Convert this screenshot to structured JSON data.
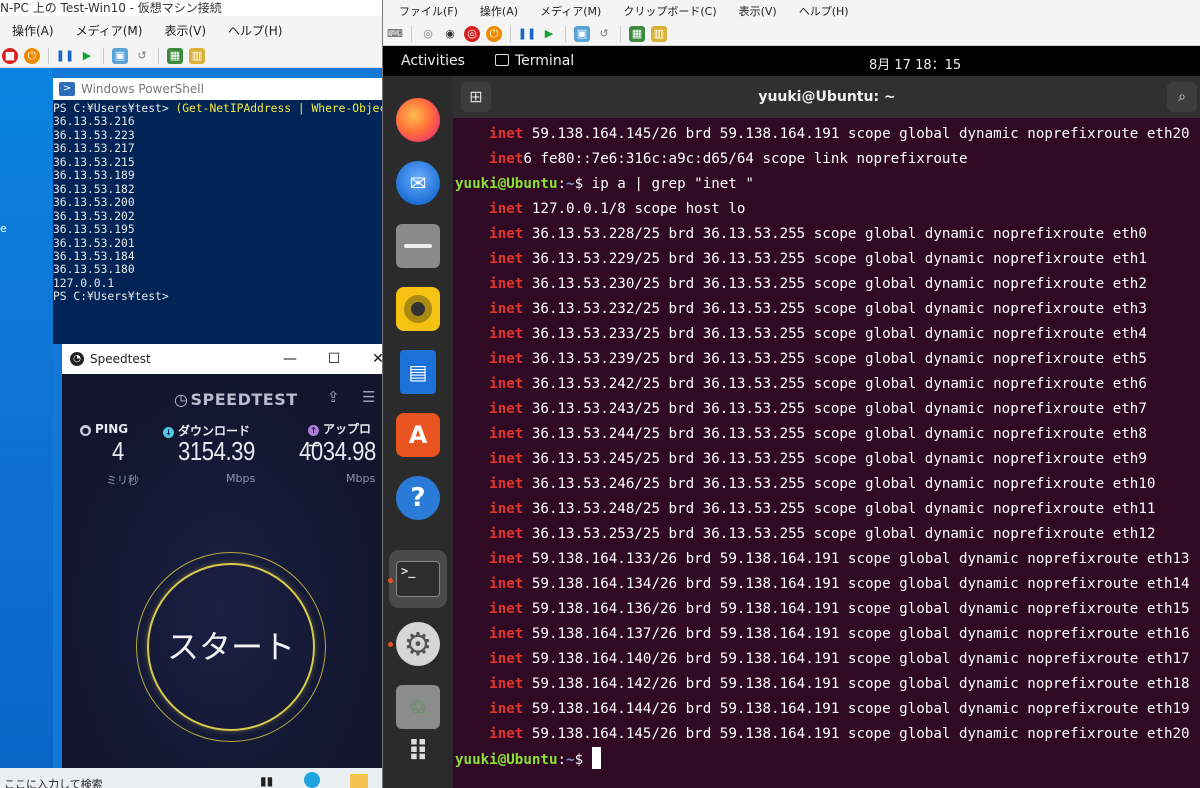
{
  "left_vm": {
    "window_title": "N-PC 上の Test-Win10 - 仮想マシン接続",
    "menu": [
      "操作(A)",
      "メディア(M)",
      "表示(V)",
      "ヘルプ(H)"
    ],
    "desktop_text": "e",
    "powershell": {
      "title": "Windows PowerShell",
      "prompt_line_prefix": "PS C:¥Users¥test> ",
      "command": "(Get-NetIPAddress | Where-Objec",
      "lines": [
        "36.13.53.216",
        "36.13.53.223",
        "36.13.53.217",
        "36.13.53.215",
        "36.13.53.189",
        "36.13.53.182",
        "36.13.53.200",
        "36.13.53.202",
        "36.13.53.195",
        "36.13.53.201",
        "36.13.53.184",
        "36.13.53.180",
        "127.0.0.1"
      ],
      "final_prompt": "PS C:¥Users¥test>"
    },
    "speedtest": {
      "title": "Speedtest",
      "logo": "SPEEDTEST",
      "ping_label": "PING",
      "ping_value": "4",
      "ping_unit": "ミリ秒",
      "download_label": "ダウンロード",
      "download_value": "3154.39",
      "download_unit": "Mbps",
      "upload_label": "アップロー",
      "upload_value": "4034.98",
      "upload_unit": "Mbps",
      "start_label": "スタート"
    },
    "taskbar_search": "ここに入力して検索"
  },
  "right_vm": {
    "menu": [
      "ファイル(F)",
      "操作(A)",
      "メディア(M)",
      "クリップボード(C)",
      "表示(V)",
      "ヘルプ(H)"
    ],
    "topbar": {
      "activities": "Activities",
      "app": "Terminal",
      "clock": "8月 17  18：15"
    },
    "terminal": {
      "title": "yuuki@Ubuntu: ~",
      "prompt_user": "yuuki@Ubuntu",
      "prompt_sep": ":",
      "prompt_path": "~",
      "prompt_sym": "$",
      "command": " ip a | grep \"inet \"",
      "top_lines": [
        {
          "kw": "inet",
          "rest": " 59.138.164.145/26 brd 59.138.164.191 scope global dynamic noprefixroute eth20"
        },
        {
          "kw": "inet",
          "rest": "6 fe80::7e6:316c:a9c:d65/64 scope link noprefixroute"
        }
      ],
      "lines": [
        {
          "kw": "inet",
          "rest": " 127.0.0.1/8 scope host lo"
        },
        {
          "kw": "inet",
          "rest": " 36.13.53.228/25 brd 36.13.53.255 scope global dynamic noprefixroute eth0"
        },
        {
          "kw": "inet",
          "rest": " 36.13.53.229/25 brd 36.13.53.255 scope global dynamic noprefixroute eth1"
        },
        {
          "kw": "inet",
          "rest": " 36.13.53.230/25 brd 36.13.53.255 scope global dynamic noprefixroute eth2"
        },
        {
          "kw": "inet",
          "rest": " 36.13.53.232/25 brd 36.13.53.255 scope global dynamic noprefixroute eth3"
        },
        {
          "kw": "inet",
          "rest": " 36.13.53.233/25 brd 36.13.53.255 scope global dynamic noprefixroute eth4"
        },
        {
          "kw": "inet",
          "rest": " 36.13.53.239/25 brd 36.13.53.255 scope global dynamic noprefixroute eth5"
        },
        {
          "kw": "inet",
          "rest": " 36.13.53.242/25 brd 36.13.53.255 scope global dynamic noprefixroute eth6"
        },
        {
          "kw": "inet",
          "rest": " 36.13.53.243/25 brd 36.13.53.255 scope global dynamic noprefixroute eth7"
        },
        {
          "kw": "inet",
          "rest": " 36.13.53.244/25 brd 36.13.53.255 scope global dynamic noprefixroute eth8"
        },
        {
          "kw": "inet",
          "rest": " 36.13.53.245/25 brd 36.13.53.255 scope global dynamic noprefixroute eth9"
        },
        {
          "kw": "inet",
          "rest": " 36.13.53.246/25 brd 36.13.53.255 scope global dynamic noprefixroute eth10"
        },
        {
          "kw": "inet",
          "rest": " 36.13.53.248/25 brd 36.13.53.255 scope global dynamic noprefixroute eth11"
        },
        {
          "kw": "inet",
          "rest": " 36.13.53.253/25 brd 36.13.53.255 scope global dynamic noprefixroute eth12"
        },
        {
          "kw": "inet",
          "rest": " 59.138.164.133/26 brd 59.138.164.191 scope global dynamic noprefixroute eth13"
        },
        {
          "kw": "inet",
          "rest": " 59.138.164.134/26 brd 59.138.164.191 scope global dynamic noprefixroute eth14"
        },
        {
          "kw": "inet",
          "rest": " 59.138.164.136/26 brd 59.138.164.191 scope global dynamic noprefixroute eth15"
        },
        {
          "kw": "inet",
          "rest": " 59.138.164.137/26 brd 59.138.164.191 scope global dynamic noprefixroute eth16"
        },
        {
          "kw": "inet",
          "rest": " 59.138.164.140/26 brd 59.138.164.191 scope global dynamic noprefixroute eth17"
        },
        {
          "kw": "inet",
          "rest": " 59.138.164.142/26 brd 59.138.164.191 scope global dynamic noprefixroute eth18"
        },
        {
          "kw": "inet",
          "rest": " 59.138.164.144/26 brd 59.138.164.191 scope global dynamic noprefixroute eth19"
        },
        {
          "kw": "inet",
          "rest": " 59.138.164.145/26 brd 59.138.164.191 scope global dynamic noprefixroute eth20"
        }
      ]
    },
    "dock": [
      {
        "name": "firefox-icon",
        "color": "#ff7139",
        "glyph": "🦊"
      },
      {
        "name": "thunderbird-icon",
        "color": "#1f6fd6",
        "glyph": "✉"
      },
      {
        "name": "files-icon",
        "color": "#8a8a8a",
        "glyph": "▬"
      },
      {
        "name": "rhythmbox-icon",
        "color": "#f5c211",
        "glyph": "◉"
      },
      {
        "name": "writer-icon",
        "color": "#1c71d8",
        "glyph": "▤"
      },
      {
        "name": "software-center-icon",
        "color": "#e95420",
        "glyph": "A"
      },
      {
        "name": "help-icon",
        "color": "#2a7bd7",
        "glyph": "?"
      },
      {
        "name": "terminal-icon",
        "color": "#3c3c3c",
        "glyph": ">_"
      },
      {
        "name": "settings-icon",
        "color": "#7a7a7a",
        "glyph": "⚙"
      },
      {
        "name": "trash-icon",
        "color": "#6e6e6e",
        "glyph": "♲"
      },
      {
        "name": "app-grid-icon",
        "color": "#2b2b2b",
        "glyph": "⠿"
      }
    ]
  }
}
